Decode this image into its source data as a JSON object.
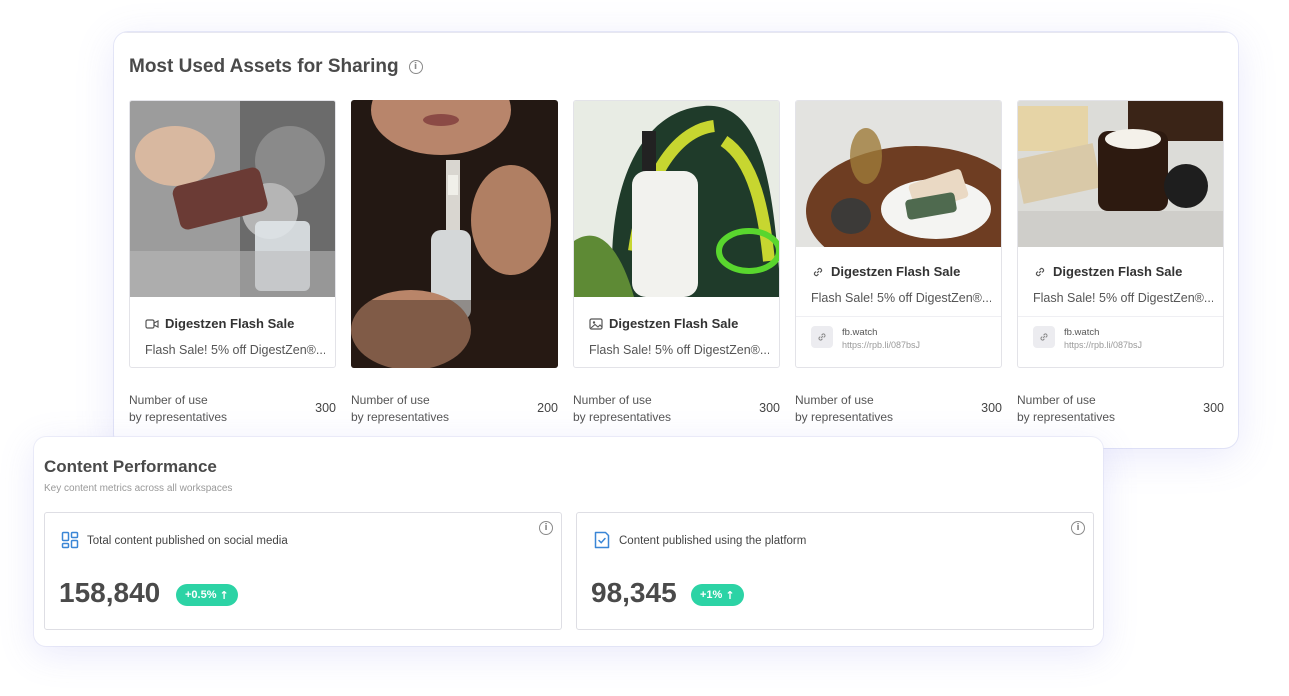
{
  "assets_section": {
    "title": "Most Used Assets for Sharing",
    "usage_label_line1": "Number of use",
    "usage_label_line2": "by representatives",
    "cards": [
      {
        "type": "video",
        "title": "Digestzen Flash Sale",
        "description": "Flash Sale! 5% off DigestZen®...",
        "count": "300"
      },
      {
        "type": "image-only",
        "count": "200"
      },
      {
        "type": "image",
        "title": "Digestzen Flash Sale",
        "description": "Flash Sale! 5% off DigestZen®...",
        "count": "300"
      },
      {
        "type": "link",
        "title": "Digestzen Flash Sale",
        "description": "Flash Sale! 5% off DigestZen®...",
        "link_domain": "fb.watch",
        "link_url": "https://rpb.li/087bsJ",
        "count": "300"
      },
      {
        "type": "link",
        "title": "Digestzen Flash Sale",
        "description": "Flash Sale! 5% off DigestZen®...",
        "link_domain": "fb.watch",
        "link_url": "https://rpb.li/087bsJ",
        "count": "300"
      }
    ]
  },
  "performance": {
    "title": "Content Performance",
    "subtitle": "Key content metrics across all workspaces",
    "metrics": [
      {
        "label": "Total content published on social media",
        "value": "158,840",
        "change": "+0.5%",
        "icon": "grid-icon"
      },
      {
        "label": "Content published using the platform",
        "value": "98,345",
        "change": "+1%",
        "icon": "checked-document-icon"
      }
    ]
  },
  "colors": {
    "accent": "#3a86d6",
    "positive": "#2cd3a5"
  }
}
